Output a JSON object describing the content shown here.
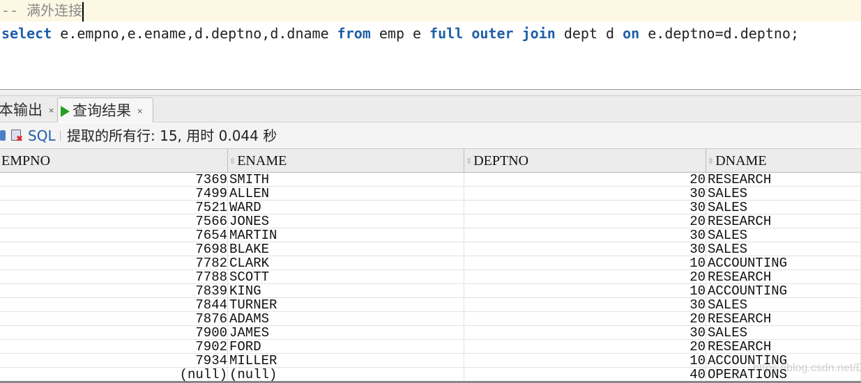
{
  "editor": {
    "comment": "-- 满外连接",
    "sql_tokens": [
      {
        "t": "select",
        "kw": true
      },
      {
        "t": " e.empno,e.ename,d.deptno,d.dname ",
        "kw": false
      },
      {
        "t": "from",
        "kw": true
      },
      {
        "t": " emp e ",
        "kw": false
      },
      {
        "t": "full",
        "kw": true
      },
      {
        "t": " ",
        "kw": false
      },
      {
        "t": "outer",
        "kw": true
      },
      {
        "t": " ",
        "kw": false
      },
      {
        "t": "join",
        "kw": true
      },
      {
        "t": " dept d ",
        "kw": false
      },
      {
        "t": "on",
        "kw": true
      },
      {
        "t": " e.deptno=d.deptno;",
        "kw": false
      }
    ]
  },
  "tabs": [
    {
      "label": "本输出",
      "close": "×",
      "icon": "none"
    },
    {
      "label": "查询结果",
      "close": "×",
      "icon": "play-icon"
    }
  ],
  "toolbar": {
    "sql_label": "SQL",
    "status": "提取的所有行: 15, 用时 0.044 秒"
  },
  "table": {
    "columns": [
      "EMPNO",
      "ENAME",
      "DEPTNO",
      "DNAME"
    ],
    "rows": [
      [
        "7369",
        "SMITH",
        "20",
        "RESEARCH"
      ],
      [
        "7499",
        "ALLEN",
        "30",
        "SALES"
      ],
      [
        "7521",
        "WARD",
        "30",
        "SALES"
      ],
      [
        "7566",
        "JONES",
        "20",
        "RESEARCH"
      ],
      [
        "7654",
        "MARTIN",
        "30",
        "SALES"
      ],
      [
        "7698",
        "BLAKE",
        "30",
        "SALES"
      ],
      [
        "7782",
        "CLARK",
        "10",
        "ACCOUNTING"
      ],
      [
        "7788",
        "SCOTT",
        "20",
        "RESEARCH"
      ],
      [
        "7839",
        "KING",
        "10",
        "ACCOUNTING"
      ],
      [
        "7844",
        "TURNER",
        "30",
        "SALES"
      ],
      [
        "7876",
        "ADAMS",
        "20",
        "RESEARCH"
      ],
      [
        "7900",
        "JAMES",
        "30",
        "SALES"
      ],
      [
        "7902",
        "FORD",
        "20",
        "RESEARCH"
      ],
      [
        "7934",
        "MILLER",
        "10",
        "ACCOUNTING"
      ],
      [
        "(null)",
        "(null)",
        "40",
        "OPERATIONS"
      ]
    ]
  },
  "watermark": "https://blog.csdn.net/Dean_xiu",
  "colors": {
    "keyword": "#1f5fa8",
    "current_line": "#fdf8e4"
  }
}
